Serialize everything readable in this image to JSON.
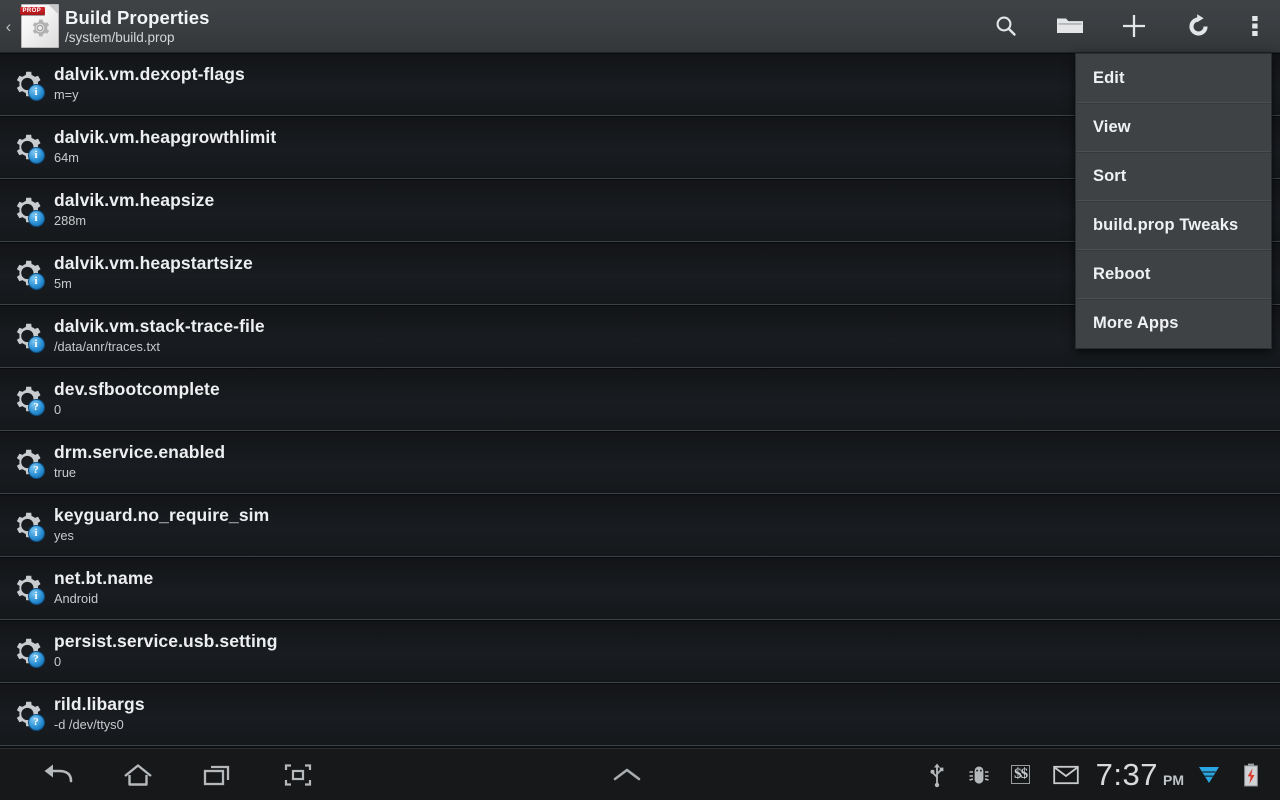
{
  "actionbar": {
    "back_glyph": "‹",
    "app_icon_tag": "PROP",
    "title": "Build Properties",
    "subtitle": "/system/build.prop",
    "actions": [
      {
        "name": "search",
        "label": "Search"
      },
      {
        "name": "open-folder",
        "label": "Open"
      },
      {
        "name": "add",
        "label": "Add"
      },
      {
        "name": "refresh",
        "label": "Refresh"
      },
      {
        "name": "overflow",
        "label": "More options"
      }
    ]
  },
  "overflow_menu": {
    "items": [
      {
        "label": "Edit"
      },
      {
        "label": "View"
      },
      {
        "label": "Sort"
      },
      {
        "label": "build.prop Tweaks"
      },
      {
        "label": "Reboot"
      },
      {
        "label": "More Apps"
      }
    ]
  },
  "list": {
    "rows": [
      {
        "key": "dalvik.vm.dexopt-flags",
        "value": "m=y",
        "badge": "i"
      },
      {
        "key": "dalvik.vm.heapgrowthlimit",
        "value": "64m",
        "badge": "i"
      },
      {
        "key": "dalvik.vm.heapsize",
        "value": "288m",
        "badge": "i"
      },
      {
        "key": "dalvik.vm.heapstartsize",
        "value": "5m",
        "badge": "i"
      },
      {
        "key": "dalvik.vm.stack-trace-file",
        "value": "/data/anr/traces.txt",
        "badge": "i"
      },
      {
        "key": "dev.sfbootcomplete",
        "value": "0",
        "badge": "?"
      },
      {
        "key": "drm.service.enabled",
        "value": "true",
        "badge": "?"
      },
      {
        "key": "keyguard.no_require_sim",
        "value": "yes",
        "badge": "i"
      },
      {
        "key": "net.bt.name",
        "value": "Android",
        "badge": "i"
      },
      {
        "key": "persist.service.usb.setting",
        "value": "0",
        "badge": "?"
      },
      {
        "key": "rild.libargs",
        "value": "-d /dev/ttys0",
        "badge": "?"
      }
    ]
  },
  "navbar": {
    "buttons": [
      {
        "name": "back",
        "label": "Back"
      },
      {
        "name": "home",
        "label": "Home"
      },
      {
        "name": "recents",
        "label": "Recent apps"
      },
      {
        "name": "screenshot",
        "label": "Screenshot"
      }
    ],
    "center_handle": "⌃",
    "status": {
      "usb": "USB connected",
      "debug": "USB debugging",
      "money_label": "$$",
      "mail": "New mail",
      "time": "7:37",
      "ampm": "PM",
      "wifi": "Wi-Fi",
      "battery": "Charging"
    }
  },
  "colors": {
    "accent_blue": "#2a8fd4",
    "tag_red": "#c21f25",
    "bar_gray": "#3a3e41",
    "list_bg": "#15181b",
    "separator": "#3b4247"
  }
}
